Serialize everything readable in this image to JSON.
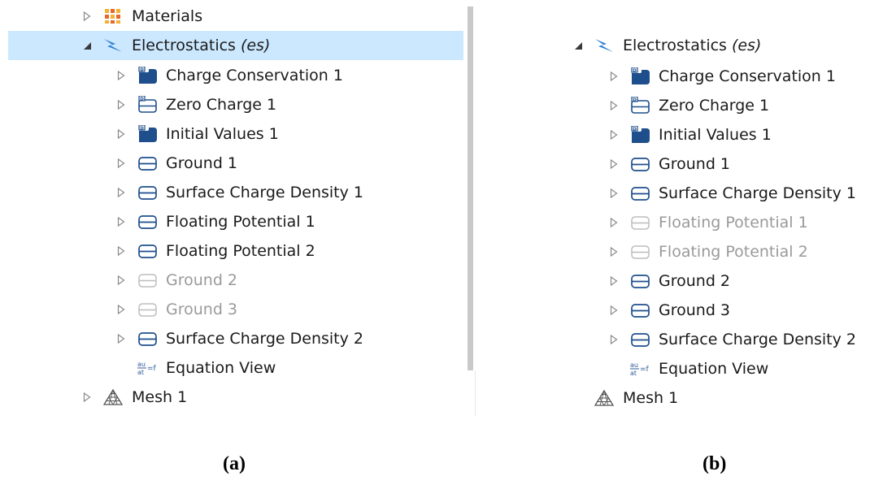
{
  "panel_a": {
    "caption": "(a)",
    "top_items": [
      {
        "label": "Materials",
        "icon": "materials-icon"
      }
    ],
    "physics": {
      "label": "Electrostatics",
      "tag": "(es)",
      "icon": "electrostatics-icon",
      "selected": true
    },
    "children": [
      {
        "label": "Charge Conservation 1",
        "icon": "default-node-icon",
        "disabled": false
      },
      {
        "label": "Zero Charge 1",
        "icon": "default-boundary-icon",
        "disabled": false
      },
      {
        "label": "Initial Values 1",
        "icon": "default-node-icon",
        "disabled": false
      },
      {
        "label": "Ground 1",
        "icon": "boundary-icon",
        "disabled": false
      },
      {
        "label": "Surface Charge Density 1",
        "icon": "boundary-icon",
        "disabled": false
      },
      {
        "label": "Floating Potential 1",
        "icon": "boundary-icon",
        "disabled": false
      },
      {
        "label": "Floating Potential 2",
        "icon": "boundary-icon",
        "disabled": false
      },
      {
        "label": "Ground 2",
        "icon": "boundary-icon",
        "disabled": true
      },
      {
        "label": "Ground 3",
        "icon": "boundary-icon",
        "disabled": true
      },
      {
        "label": "Surface Charge Density 2",
        "icon": "boundary-icon",
        "disabled": false
      },
      {
        "label": "Equation View",
        "icon": "equation-view-icon",
        "disabled": false
      }
    ],
    "mesh": {
      "label": "Mesh 1",
      "icon": "mesh-icon"
    }
  },
  "panel_b": {
    "caption": "(b)",
    "physics": {
      "label": "Electrostatics",
      "tag": "(es)",
      "icon": "electrostatics-icon"
    },
    "children": [
      {
        "label": "Charge Conservation 1",
        "icon": "default-node-icon",
        "disabled": false
      },
      {
        "label": "Zero Charge 1",
        "icon": "default-boundary-icon",
        "disabled": false
      },
      {
        "label": "Initial Values 1",
        "icon": "default-node-icon",
        "disabled": false
      },
      {
        "label": "Ground 1",
        "icon": "boundary-icon",
        "disabled": false
      },
      {
        "label": "Surface Charge Density 1",
        "icon": "boundary-icon",
        "disabled": false
      },
      {
        "label": "Floating Potential 1",
        "icon": "boundary-icon",
        "disabled": true
      },
      {
        "label": "Floating Potential 2",
        "icon": "boundary-icon",
        "disabled": true
      },
      {
        "label": "Ground 2",
        "icon": "boundary-icon",
        "disabled": false
      },
      {
        "label": "Ground 3",
        "icon": "boundary-icon",
        "disabled": false
      },
      {
        "label": "Surface Charge Density 2",
        "icon": "boundary-icon",
        "disabled": false
      },
      {
        "label": "Equation View",
        "icon": "equation-view-icon",
        "disabled": false
      }
    ],
    "mesh": {
      "label": "Mesh 1",
      "icon": "mesh-icon"
    }
  },
  "colors": {
    "selection": "#cce8ff",
    "node_blue": "#1e4e8c",
    "electrostatics_blue": "#2f7fd6",
    "disabled_text": "#9a9a9a",
    "materials_orange": "#f0a030"
  }
}
